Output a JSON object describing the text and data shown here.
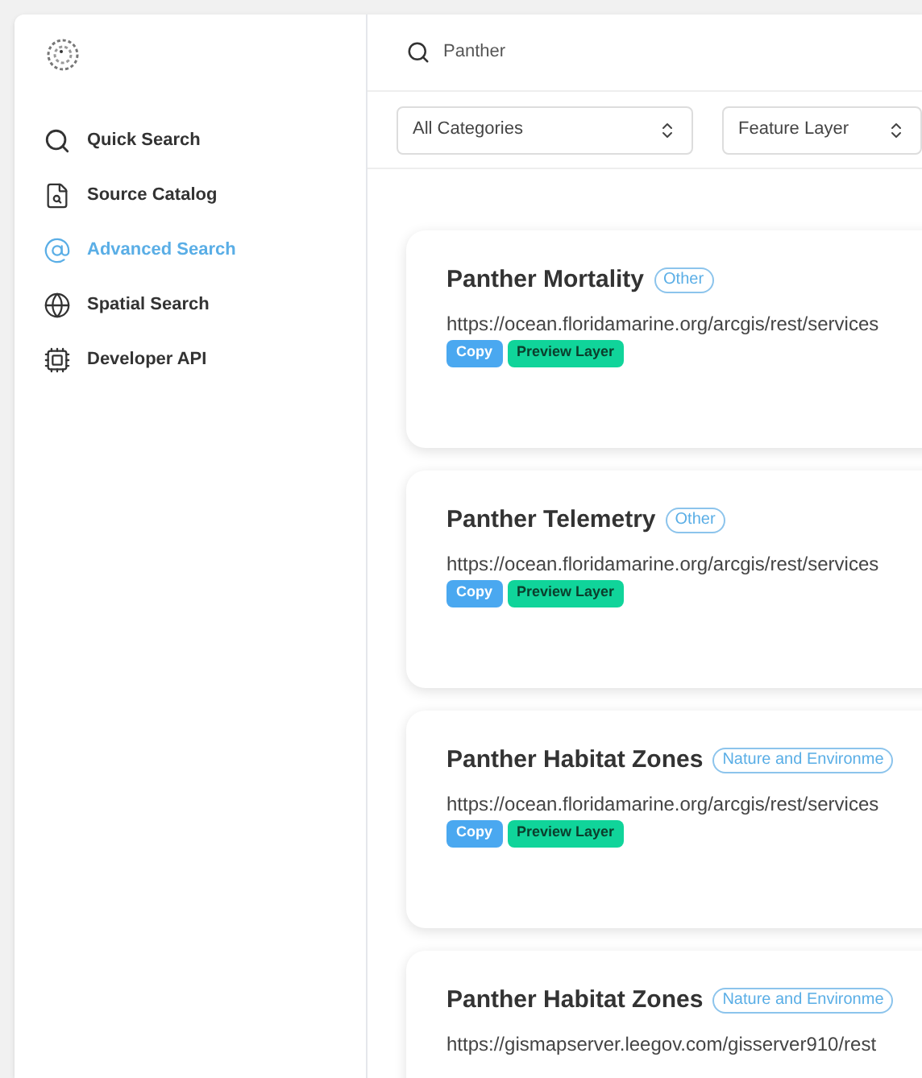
{
  "sidebar": {
    "items": [
      {
        "label": "Quick Search",
        "kind": "search",
        "selected": false
      },
      {
        "label": "Source Catalog",
        "kind": "catalog",
        "selected": false
      },
      {
        "label": "Advanced Search",
        "kind": "advanced",
        "selected": true
      },
      {
        "label": "Spatial Search",
        "kind": "spatial",
        "selected": false
      },
      {
        "label": "Developer API",
        "kind": "api",
        "selected": false
      }
    ]
  },
  "search": {
    "value": "Panther"
  },
  "filters": [
    {
      "value": "All Categories"
    },
    {
      "value": "Feature Layer"
    }
  ],
  "results": [
    {
      "title": "Panther Mortality",
      "tag": "Other",
      "url": "https://ocean.floridamarine.org/arcgis/rest/services",
      "buttons": [
        {
          "label": "Copy",
          "kind": "copy"
        },
        {
          "label": "Preview Layer",
          "kind": "preview"
        }
      ]
    },
    {
      "title": "Panther Telemetry",
      "tag": "Other",
      "url": "https://ocean.floridamarine.org/arcgis/rest/services",
      "buttons": [
        {
          "label": "Copy",
          "kind": "copy"
        },
        {
          "label": "Preview Layer",
          "kind": "preview"
        }
      ]
    },
    {
      "title": "Panther Habitat Zones",
      "tag": "Nature and Environme",
      "url": "https://ocean.floridamarine.org/arcgis/rest/services",
      "buttons": [
        {
          "label": "Copy",
          "kind": "copy"
        },
        {
          "label": "Preview Layer",
          "kind": "preview"
        }
      ]
    },
    {
      "title": "Panther Habitat Zones",
      "tag": "Nature and Environme",
      "url": "https://gismapserver.leegov.com/gisserver910/rest"
    }
  ]
}
